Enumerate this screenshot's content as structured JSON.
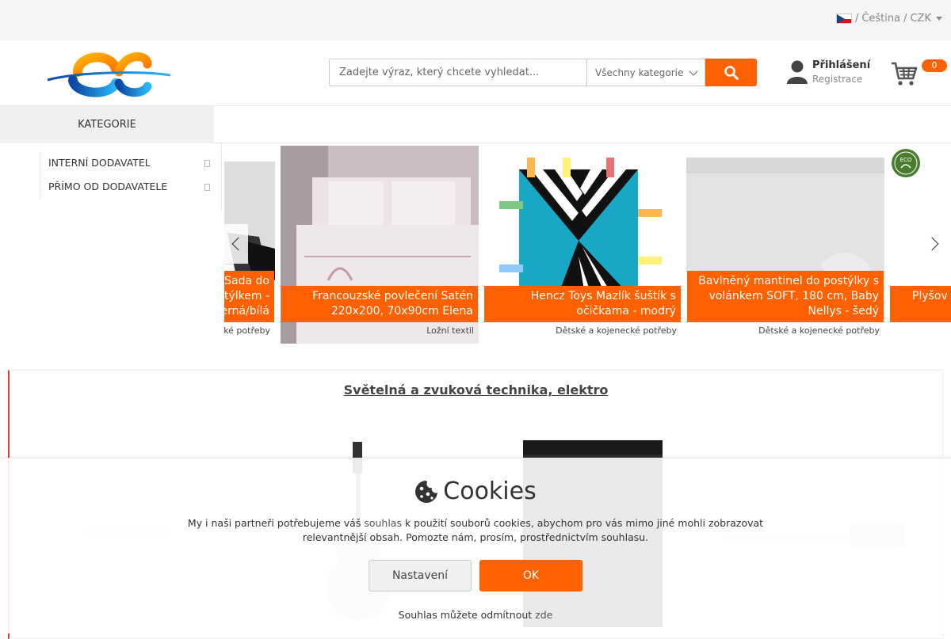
{
  "topbar": {
    "separator1": "/",
    "language": "Čeština",
    "separator2": "/",
    "currency": "CZK"
  },
  "search": {
    "placeholder": "Zadejte výraz, který chcete vyhledat...",
    "category_select": "Všechny kategorie",
    "icon": "search-icon"
  },
  "account": {
    "login": "Přihlášení",
    "register": "Registrace",
    "icon": "user-icon"
  },
  "cart": {
    "count": "0",
    "icon": "cart-icon"
  },
  "categories": {
    "title": "KATEGORIE",
    "items": [
      {
        "label": "INTERNÍ DODAVATEL"
      },
      {
        "label": "PŘÍMO OD DODAVATELE"
      }
    ]
  },
  "carousel": {
    "slides": [
      {
        "caption": "Sada do postýlky s mantinelem otýlkem - černá/bílá",
        "caption_visible": "Sada do\notýlkem -\nerná/bílá",
        "category": "ké potřeby"
      },
      {
        "caption": "Francouzské povlečení Satén 220x200, 70x90cm Elena",
        "category": "Ložní textil"
      },
      {
        "caption": "Hencz Toys Mazlík šuštík s očičkama - modrý",
        "category": "Dětské a kojenecké potřeby"
      },
      {
        "caption": "Bavlněný mantinel do postýlky s volánkem SOFT, 180 cm, Baby Nellys - šedý",
        "category": "Dětské a kojenecké potřeby"
      },
      {
        "caption": "Plyšov",
        "category": ""
      }
    ]
  },
  "section": {
    "title": "Světelná a zvuková technika, elektro"
  },
  "cookies": {
    "title": "Cookies",
    "text_before": "My i naši partneři potřebujeme váš ",
    "text_link": "souhlas",
    "text_after": " k použití souborů cookies, abychom pro vás mimo jiné mohli zobrazovat relevantnější obsah. Pomozte nám, prosím, prostřednictvím souhlasu.",
    "settings_button": "Nastavení",
    "ok_button": "OK",
    "footer_before": "Souhlas můžete odmítnout ",
    "footer_link": "zde"
  },
  "colors": {
    "accent": "#ff6000",
    "section_border": "#e53935"
  }
}
